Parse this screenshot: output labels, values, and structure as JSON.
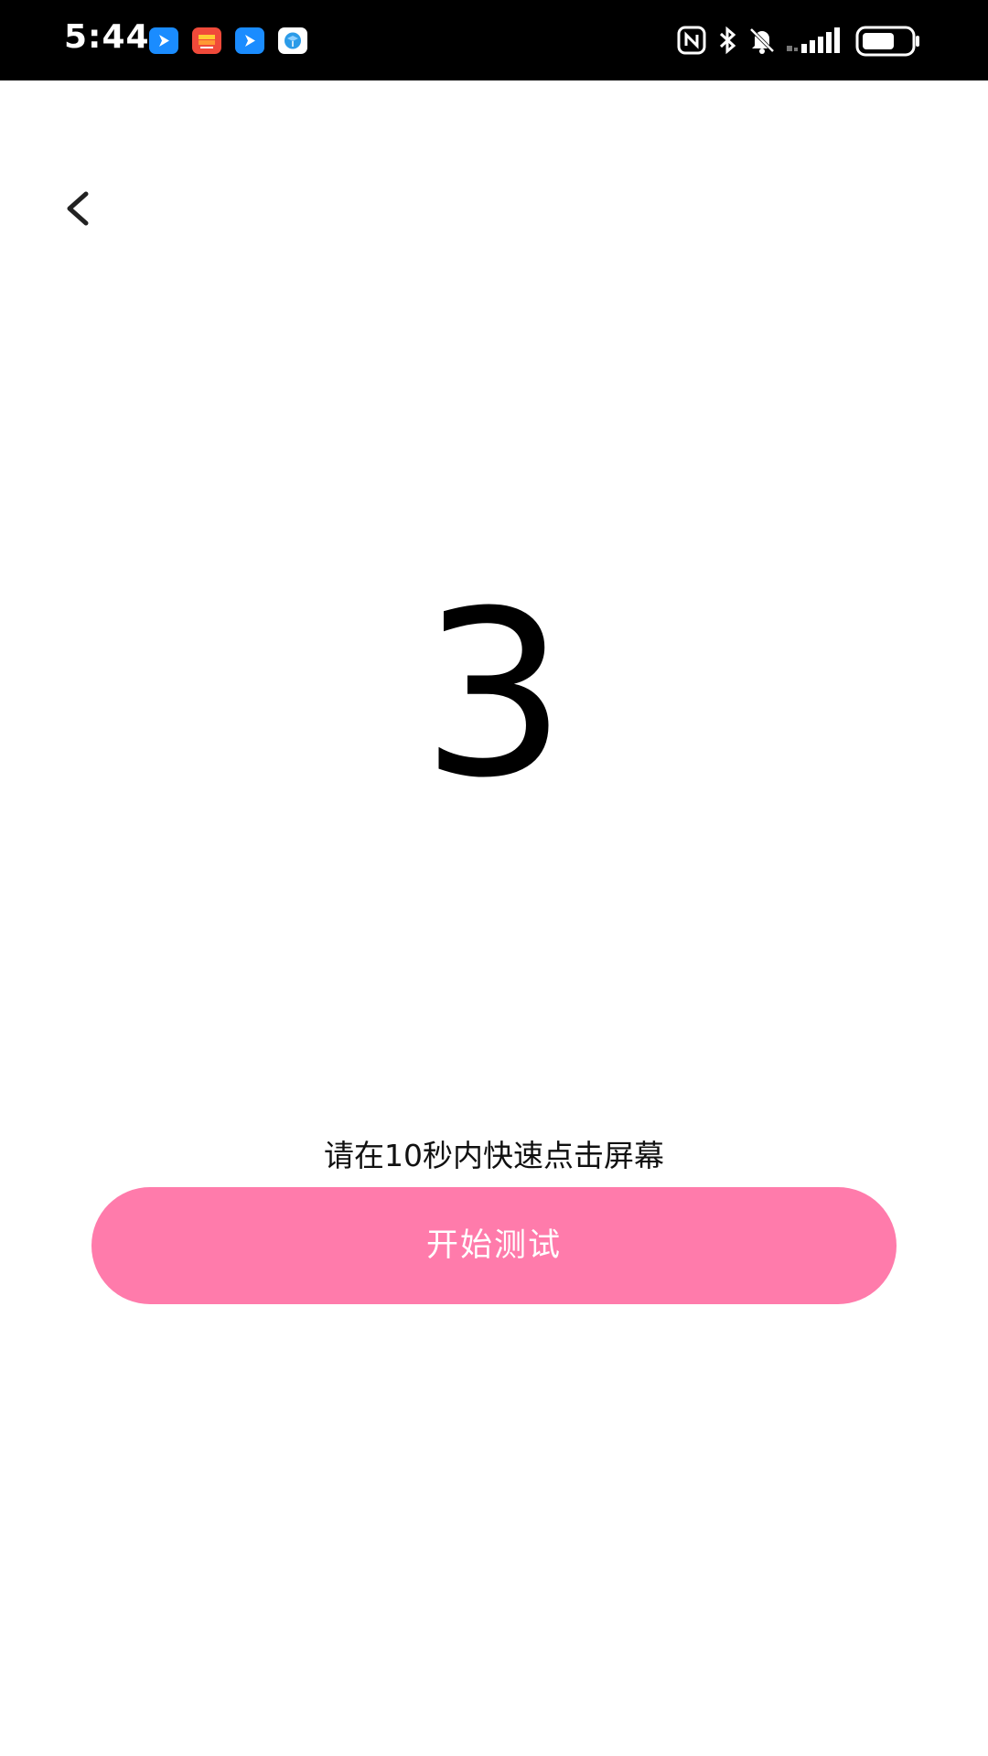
{
  "status_bar": {
    "time": "5:44",
    "notification_icons": [
      "send-app-icon",
      "image-app-icon",
      "send-app-icon",
      "cube-app-icon"
    ],
    "system_icons": [
      "nfc-icon",
      "bluetooth-icon",
      "mute-bell-icon",
      "signal-icon",
      "battery-icon"
    ],
    "battery_level": 0.6
  },
  "nav": {
    "back_icon": "chevron-left-icon"
  },
  "countdown": {
    "value": "3"
  },
  "hint": {
    "text": "请在10秒内快速点击屏幕"
  },
  "start_button": {
    "label": "开始测试",
    "color": "#ff7bab"
  }
}
